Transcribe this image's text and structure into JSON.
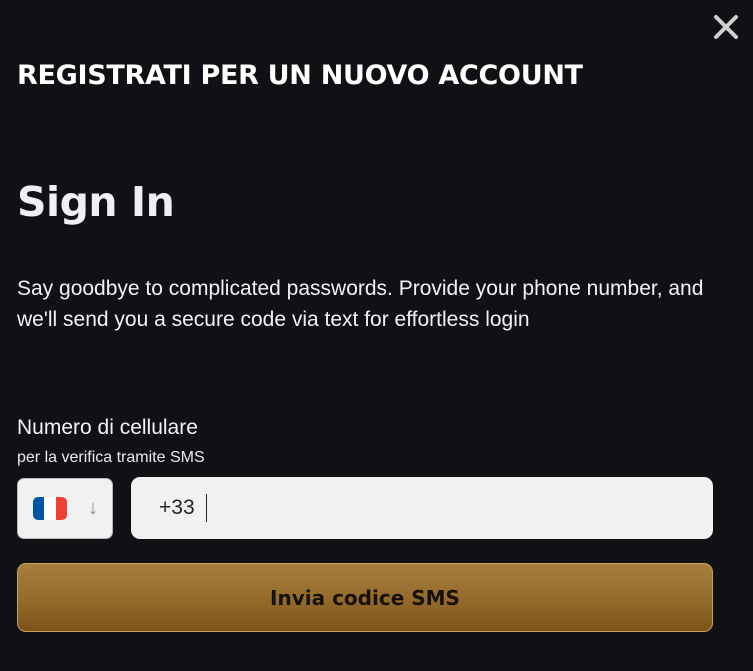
{
  "modal": {
    "title": "REGISTRATI PER UN NUOVO ACCOUNT",
    "close_icon": "close-icon"
  },
  "signin": {
    "heading": "Sign In",
    "description": "Say goodbye to complicated passwords. Provide your phone number, and we'll send you a secure code via text for effortless login"
  },
  "phone": {
    "label": "Numero di cellulare",
    "sublabel": "per la verifica tramite SMS",
    "country": {
      "flag": "france-flag-icon",
      "flag_colors": [
        "#0055A4",
        "#FFFFFF",
        "#EF4135"
      ],
      "arrow": "↓"
    },
    "input_value": "+33"
  },
  "submit": {
    "label": "Invia codice SMS"
  },
  "colors": {
    "background": "#101114",
    "button_top": "#a67e3d",
    "button_bottom": "#7d5418",
    "input_bg": "#f1f1f1"
  }
}
